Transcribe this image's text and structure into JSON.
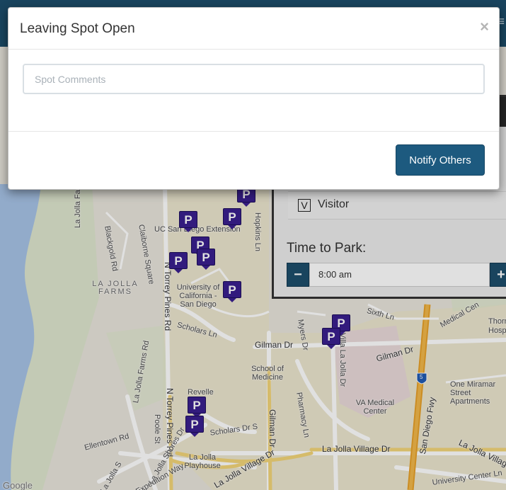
{
  "modal": {
    "title": "Leaving Spot Open",
    "close_glyph": "×",
    "comments_placeholder": "Spot Comments",
    "comments_value": "",
    "notify_label": "Notify Others"
  },
  "panel": {
    "visitor_check": "V",
    "visitor_label": "Visitor",
    "time_label": "Time to Park:",
    "time_value": "8:00 am",
    "minus": "−",
    "plus": "+"
  },
  "topbar": {
    "menu_glyph": "≡"
  },
  "map": {
    "marker_glyph": "P",
    "labels": {
      "la_jolla_farms_rd_top": "La Jolla Farms",
      "blackgold_rd": "Blackgold Rd",
      "claiborne_square": "Claiborne Square",
      "ucsd_extension": "UC San Diego Extension",
      "university": "University of California - San Diego",
      "la_jolla_farms_area": "LA JOLLA FARMS",
      "n_torrey_pines_rd_1": "N Torrey Pines Rd",
      "n_torrey_pines_rd_2": "N Torrey Pines Rd",
      "hopkins_ln": "Hopkins Ln",
      "scholars_ln": "Scholars Ln",
      "la_jolla_farms_rd_side": "La Jolla Farms Rd",
      "gilman_dr_1": "Gilman Dr",
      "gilman_dr_2": "Gilman Dr",
      "gilman_dr_3": "Gilman Dr",
      "myers_dr": "Myers Dr",
      "school_of_medicine": "School of Medicine",
      "revelle": "Revelle",
      "villa_la_jolla_dr": "Villa La Jolla Dr",
      "sixth_ln": "Sixth Ln",
      "medical_center_dr": "Medical Cen",
      "thornton_hosp": "Thorn Hosp",
      "va_medical_center": "VA Medical Center",
      "one_miramar": "One Miramar Street Apartments",
      "san_diego_fwy": "San Diego Fwy",
      "pharmacy_ln": "Pharmacy Ln",
      "la_jolla_shores_dr": "La Jolla Shores Dr",
      "poole_st": "Poole St",
      "ellentown_rd": "Ellentown Rd",
      "scholars_dr_s": "Scholars Dr S",
      "la_jolla_village_dr_1": "La Jolla Village Dr",
      "la_jolla_village_dr_2": "La Jolla Village Dr",
      "la_jolla_village_dr_3": "La Jolla Village",
      "la_jolla_playhouse": "La Jolla Playhouse",
      "university_center_ln": "University Center Ln",
      "la_jolla_scenic": "La Jolla S",
      "expedition_way": "Expedition Way",
      "google": "Google",
      "hwy_5": "5"
    }
  }
}
